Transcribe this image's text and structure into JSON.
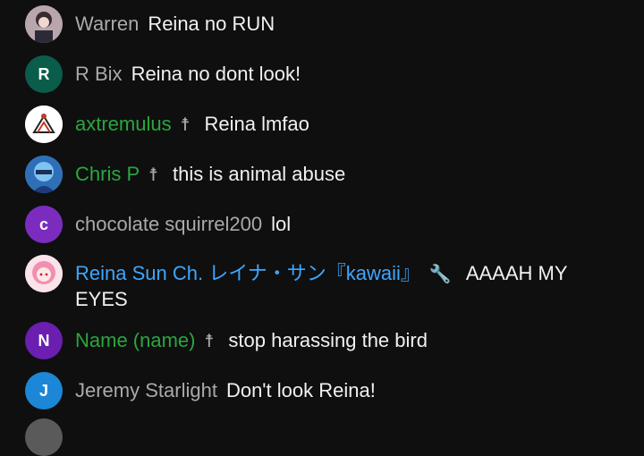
{
  "colors": {
    "background": "#0f0f0f",
    "author_default": "#aaaaaa",
    "author_member": "#2ba640",
    "author_owner": "#3ea6ff",
    "message": "#f1f1f1"
  },
  "messages": [
    {
      "author": "Warren",
      "text": "Reina no RUN",
      "avatar_letter": "",
      "avatar_color": "#8d7f86",
      "author_type": "default",
      "badge": ""
    },
    {
      "author": "R Bix",
      "text": "Reina no dont look!",
      "avatar_letter": "R",
      "avatar_color": "#0a5c4b",
      "author_type": "default",
      "badge": ""
    },
    {
      "author": "axtremulus",
      "text": "Reina lmfao",
      "avatar_letter": "",
      "avatar_color": "#ffffff",
      "author_type": "member",
      "badge": "verified-cross-icon"
    },
    {
      "author": "Chris P",
      "text": "this is animal abuse",
      "avatar_letter": "",
      "avatar_color": "#4f8fd1",
      "author_type": "member",
      "badge": "verified-cross-icon"
    },
    {
      "author": "chocolate squirrel200",
      "text": "lol",
      "avatar_letter": "c",
      "avatar_color": "#7b2cbf",
      "author_type": "default",
      "badge": ""
    },
    {
      "author": "Reina Sun Ch. レイナ・サン『kawaii』",
      "text": "AAAAH MY EYES",
      "avatar_letter": "",
      "avatar_color": "#f4b7c6",
      "author_type": "owner",
      "badge": "wrench-icon"
    },
    {
      "author": "Name (name)",
      "text": "stop harassing the bird",
      "avatar_letter": "N",
      "avatar_color": "#6a1fb0",
      "author_type": "member",
      "badge": "verified-cross-icon"
    },
    {
      "author": "Jeremy Starlight",
      "text": "Don't look Reina!",
      "avatar_letter": "J",
      "avatar_color": "#1c87d6",
      "author_type": "default",
      "badge": ""
    }
  ]
}
